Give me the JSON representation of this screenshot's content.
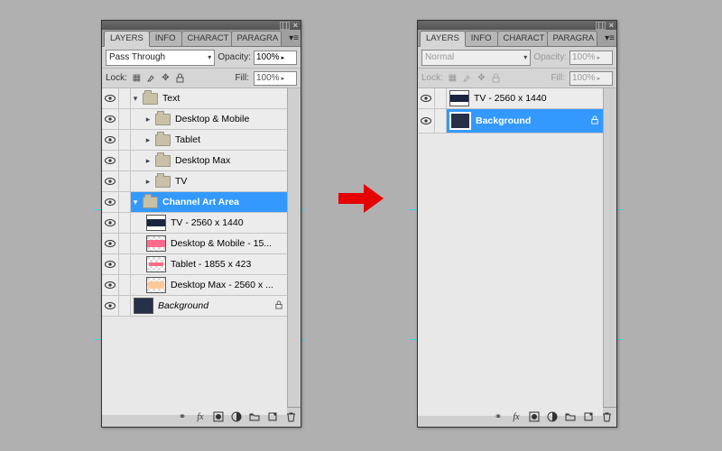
{
  "tabs": [
    "LAYERS",
    "INFO",
    "CHARACT",
    "PARAGRA"
  ],
  "left": {
    "blend_mode": "Pass Through",
    "opacity_label": "Opacity:",
    "opacity_value": "100%",
    "lock_label": "Lock:",
    "fill_label": "Fill:",
    "fill_value": "100%",
    "layers": {
      "text_group": "Text",
      "desktop_mobile": "Desktop & Mobile",
      "tablet": "Tablet",
      "desktop_max": "Desktop Max",
      "tv": "TV",
      "channel_art": "Channel Art Area",
      "tv_layer": "TV - 2560 x 1440",
      "dm_layer": "Desktop & Mobile - 15...",
      "tablet_layer": "Tablet - 1855 x 423",
      "dmax_layer": "Desktop Max - 2560 x ...",
      "background": "Background"
    }
  },
  "right": {
    "blend_mode": "Normal",
    "opacity_label": "Opacity:",
    "opacity_value": "100%",
    "lock_label": "Lock:",
    "fill_label": "Fill:",
    "fill_value": "100%",
    "layers": {
      "tv_layer": "TV - 2560 x 1440",
      "background": "Background"
    }
  },
  "chart_data": null
}
